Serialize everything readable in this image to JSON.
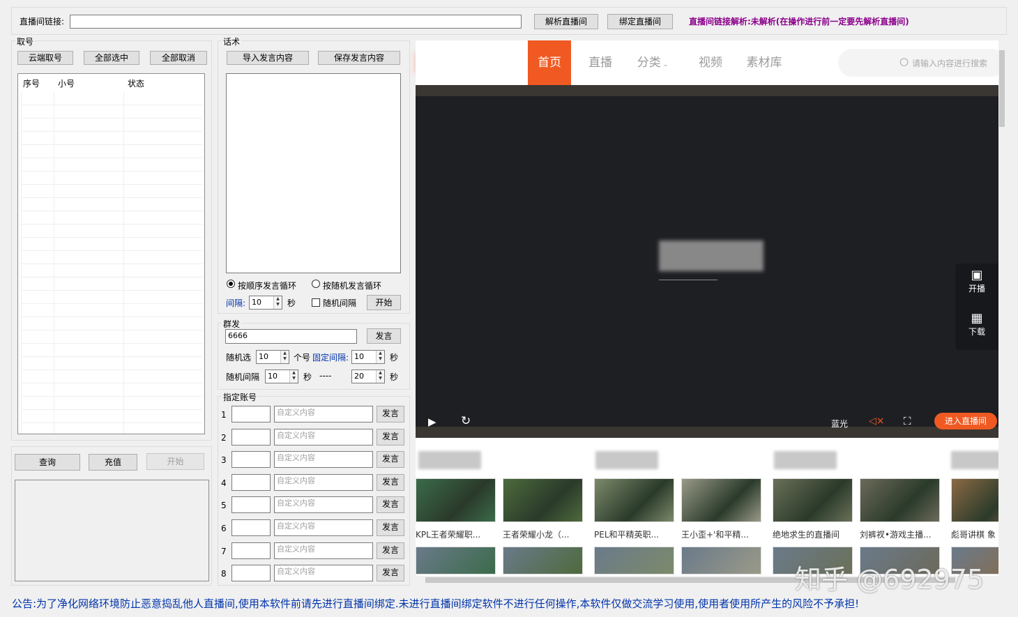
{
  "top": {
    "link_label": "直播间链接:",
    "link_value": "",
    "parse_button": "解析直播间",
    "bind_button": "绑定直播间",
    "status_text": "直播间链接解析:未解析(在操作进行前一定要先解析直播间)"
  },
  "accounts": {
    "group_label": "取号",
    "cloud_button": "云端取号",
    "select_all_button": "全部选中",
    "deselect_all_button": "全部取消",
    "columns": [
      "序号",
      "小号",
      "状态"
    ],
    "rows": []
  },
  "bottom_left": {
    "query_button": "查询",
    "recharge_button": "充值",
    "start_button": "开始"
  },
  "script": {
    "group_label": "话术",
    "import_button": "导入发言内容",
    "save_button": "保存发言内容",
    "content": "",
    "radio_sequential": "按顺序发言循环",
    "radio_random": "按随机发言循环",
    "interval_label": "间隔:",
    "interval_value": "10",
    "seconds": "秒",
    "random_interval_label": "随机间隔",
    "start_button": "开始"
  },
  "mass": {
    "group_label": "群发",
    "message_value": "6666",
    "send_button": "发言",
    "random_pick_label": "随机选",
    "random_pick_value": "10",
    "count_fixed_label": "个号",
    "fixed_interval_label": "固定间隔:",
    "fixed_interval_value": "10",
    "seconds": "秒",
    "random_interval_label": "随机间隔",
    "random_min_value": "10",
    "dash": "----",
    "random_max_value": "20"
  },
  "assigned": {
    "group_label": "指定账号",
    "placeholder": "自定义内容",
    "send_button": "发言",
    "rows": [
      "1",
      "2",
      "3",
      "4",
      "5",
      "6",
      "7",
      "8"
    ]
  },
  "web": {
    "nav": [
      "首页",
      "直播",
      "分类",
      "视频",
      "素材库"
    ],
    "search_placeholder": "请输入内容进行搜索",
    "side_start_label": "开播",
    "side_download_label": "下载",
    "quality_label": "蓝光",
    "enter_button": "进入直播间",
    "videos": [
      "KPL王者荣耀职...",
      "王者荣耀小龙（...",
      "PEL和平精英职...",
      "王小歪+'和平精...",
      "绝地求生的直播间",
      "刘裤衩•游戏主播...",
      "彪哥讲棋 象"
    ],
    "watermark": "知乎 @692975"
  },
  "notice": "公告:为了净化网络环境防止恶意捣乱他人直播间,使用本软件前请先进行直播间绑定.未进行直播间绑定软件不进行任何操作,本软件仅做交流学习使用,使用者使用所产生的风险不予承担!",
  "colors": {
    "accent_orange": "#f05a22",
    "status_purple": "#8b008b",
    "notice_blue": "#0033aa"
  }
}
